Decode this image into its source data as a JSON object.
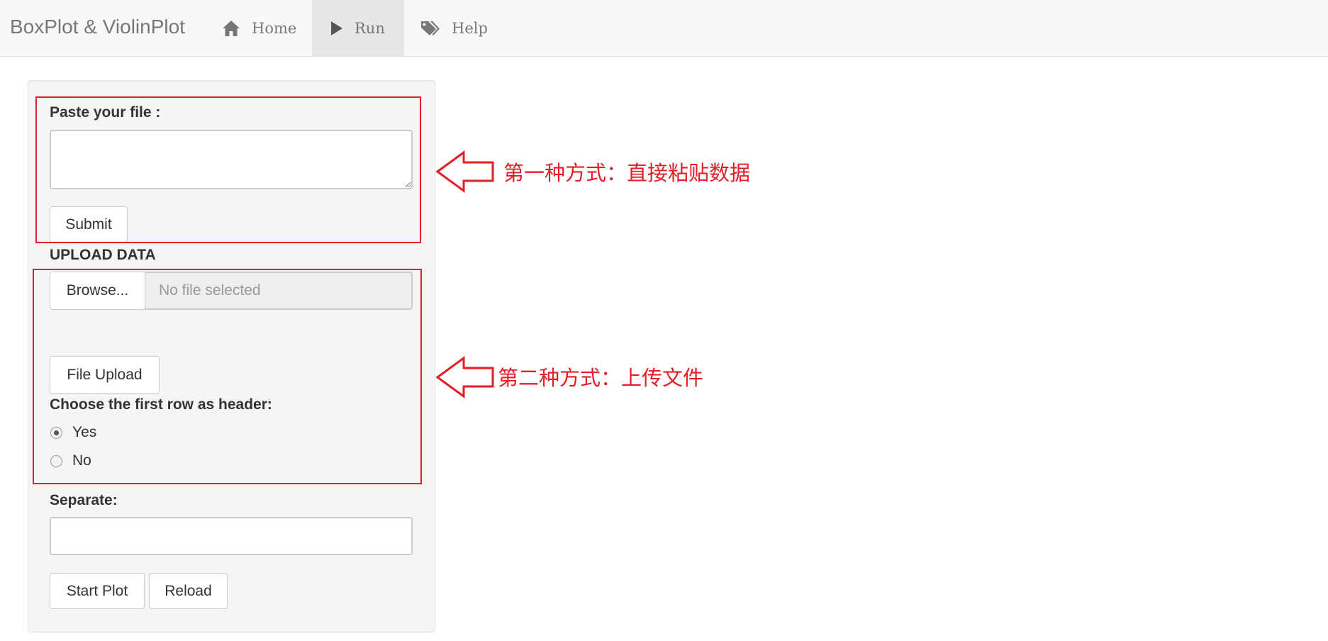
{
  "navbar": {
    "brand": "BoxPlot & ViolinPlot",
    "items": [
      {
        "label": "Home",
        "icon": "home-icon",
        "active": false
      },
      {
        "label": "Run",
        "icon": "play-icon",
        "active": true
      },
      {
        "label": "Help",
        "icon": "tags-icon",
        "active": false
      }
    ]
  },
  "paste_section": {
    "label": "Paste your file :",
    "textarea_value": "",
    "submit_label": "Submit"
  },
  "upload_section": {
    "title": "UPLOAD DATA",
    "browse_label": "Browse...",
    "file_placeholder": "No file selected",
    "upload_label": "File Upload",
    "header_question": "Choose the first row as header:",
    "options": [
      {
        "label": "Yes",
        "checked": true
      },
      {
        "label": "No",
        "checked": false
      }
    ]
  },
  "separate_section": {
    "label": "Separate:",
    "value": ""
  },
  "actions": {
    "start_label": "Start Plot",
    "reload_label": "Reload"
  },
  "annotations": {
    "first_method": "第一种方式：直接粘贴数据",
    "second_method": "第二种方式：上传文件",
    "color": "#e21e26"
  }
}
